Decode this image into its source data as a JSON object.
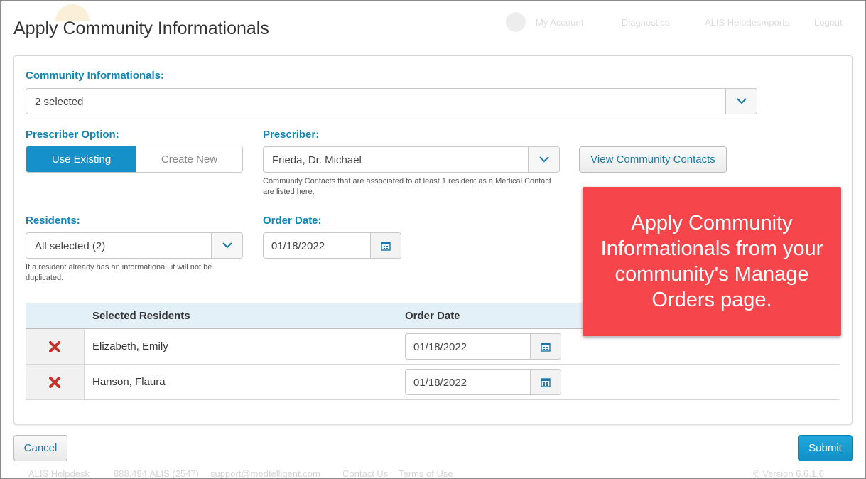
{
  "background": {
    "nav": {
      "my_account": "My Account",
      "diagnostics": "Diagnostics",
      "helpdesk": "ALIS Helpdesmports",
      "logout": "Logout"
    },
    "footer": {
      "helpdesk": "ALIS Helpdesk",
      "phone": "888.494.ALIS (2547)",
      "email": "support@medtelligent.com",
      "contact": "Contact Us",
      "terms": "Terms of Use",
      "version": "© Version 6.6.1.0"
    }
  },
  "modal": {
    "title": "Apply Community Informationals",
    "community_informationals": {
      "label": "Community Informationals:",
      "value": "2 selected"
    },
    "prescriber_option": {
      "label": "Prescriber Option:",
      "options": [
        "Use Existing",
        "Create New"
      ],
      "selected": "Use Existing"
    },
    "prescriber": {
      "label": "Prescriber:",
      "value": "Frieda, Dr. Michael",
      "help": "Community Contacts that are associated to at least 1 resident as a Medical Contact are listed here."
    },
    "view_contacts_label": "View Community Contacts",
    "residents": {
      "label": "Residents:",
      "value": "All selected (2)",
      "help": "If a resident already has an informational, it will not be duplicated."
    },
    "order_date": {
      "label": "Order Date:",
      "value": "01/18/2022"
    },
    "table": {
      "columns": [
        "Selected Residents",
        "Order Date"
      ],
      "rows": [
        {
          "name": "Elizabeth, Emily",
          "order_date": "01/18/2022"
        },
        {
          "name": "Hanson, Flaura",
          "order_date": "01/18/2022"
        }
      ]
    },
    "cancel_label": "Cancel",
    "submit_label": "Submit"
  },
  "callout": {
    "text": "Apply Community Informationals from your community's Manage Orders page."
  },
  "colors": {
    "accent": "#1590c8",
    "label": "#1385b5",
    "callout": "#f7454c",
    "remove_icon": "#c9302c"
  }
}
